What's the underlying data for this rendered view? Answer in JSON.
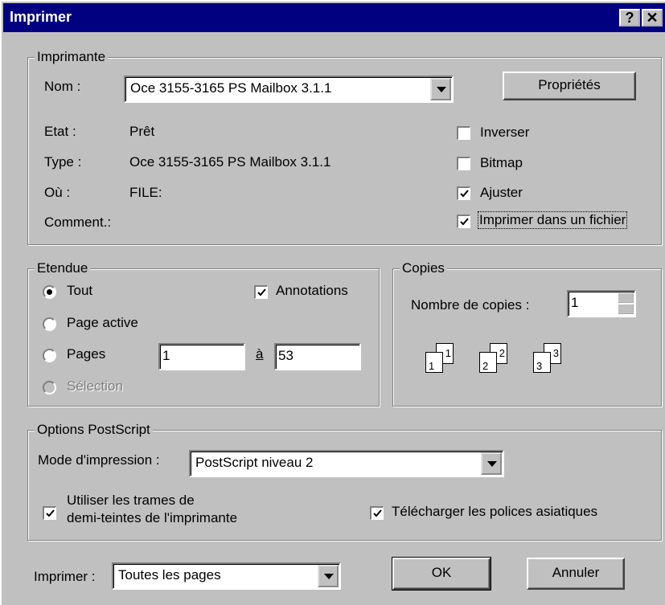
{
  "window": {
    "title": "Imprimer",
    "help_label": "?",
    "close_label": "✕"
  },
  "printer": {
    "legend": "Imprimante",
    "name_label": "Nom :",
    "name_value": "Oce 3155-3165 PS Mailbox 3.1.1",
    "properties_label": "Propriétés",
    "state_label": "Etat :",
    "state_value": "Prêt",
    "type_label": "Type :",
    "type_value": "Oce 3155-3165 PS Mailbox 3.1.1",
    "where_label": "Où :",
    "where_value": "FILE:",
    "comment_label": "Comment.:",
    "invert_label": "Inverser",
    "invert_checked": false,
    "bitmap_label": "Bitmap",
    "bitmap_checked": false,
    "fit_label": "Ajuster",
    "fit_checked": true,
    "to_file_label": "Imprimer dans un fichier",
    "to_file_checked": true
  },
  "range": {
    "legend": "Etendue",
    "all_label": "Tout",
    "current_label": "Page active",
    "pages_label": "Pages",
    "selection_label": "Sélection",
    "annotations_label": "Annotations",
    "annotations_checked": true,
    "from_value": "1",
    "to_label": "à",
    "to_value": "53"
  },
  "copies": {
    "legend": "Copies",
    "count_label": "Nombre de copies :",
    "count_value": "1",
    "pages": [
      "1",
      "1",
      "2",
      "2",
      "3",
      "3"
    ]
  },
  "postscript": {
    "legend": "Options PostScript",
    "mode_label": "Mode d'impression :",
    "mode_value": "PostScript niveau 2",
    "halftone_label_line1": "Utiliser les trames de",
    "halftone_label_line2": "demi-teintes de l'imprimante",
    "halftone_checked": true,
    "asian_fonts_label": "Télécharger les polices asiatiques",
    "asian_fonts_checked": true
  },
  "footer": {
    "print_label": "Imprimer :",
    "print_value": "Toutes les pages",
    "ok_label": "OK",
    "cancel_label": "Annuler"
  },
  "colors": {
    "title_bar": "#000080",
    "face": "#c0c0c0"
  }
}
